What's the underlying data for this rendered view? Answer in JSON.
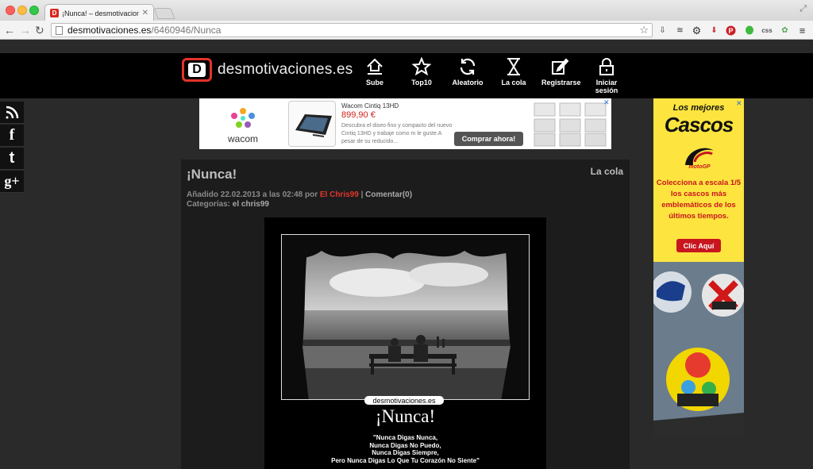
{
  "browser": {
    "tab_title": "¡Nunca! – desmotivaciones",
    "tab_close": "✕",
    "favicon_letter": "D",
    "url_domain": "desmotivaciones.es",
    "url_path": "/6460946/Nunca",
    "ext_css": "css"
  },
  "site": {
    "logo_letter": "D",
    "logo_text": "desmotivaciones.es",
    "nav": [
      {
        "label": "Sube"
      },
      {
        "label": "Top10"
      },
      {
        "label": "Aleatorio"
      },
      {
        "label": "La cola"
      },
      {
        "label": "Registrarse"
      },
      {
        "label": "Iniciar sesión"
      }
    ]
  },
  "social": [
    "rss",
    "f",
    "t",
    "g+"
  ],
  "top_ad": {
    "brand": "wacom",
    "title": "Wacom Cintiq 13HD",
    "price": "899,90 €",
    "description": "Descubra el diseo fino y compacto del nuevo Cintiq 13HD y trabaje como m le guste.A pesar de su reducido...",
    "button": "Comprar ahora!",
    "close": "✕"
  },
  "side_ad": {
    "line1": "Los mejores",
    "line2": "Cascos",
    "brand": "motoGP",
    "promo": "Colecciona a escala 1/5 los cascos más emblemáticos de los últimos tiempos.",
    "button": "Clic Aquí",
    "close": "✕"
  },
  "post": {
    "title": "¡Nunca!",
    "queue": "La cola",
    "meta_prefix": "Añadido 22.02.2013 a las 02:48 por ",
    "author": "El Chris99",
    "meta_sep": " | ",
    "comments": "Comentar(0)",
    "cats_label": "Categorías: ",
    "category": "el chris99"
  },
  "poster": {
    "watermark": "desmotivaciones.es",
    "title": "¡Nunca!",
    "lines": [
      "\"Nunca Digas Nunca,",
      "Nunca Digas No Puedo,",
      "Nunca Digas Siempre,",
      "Pero Nunca Digas Lo Que Tu Corazón No Siente\""
    ]
  },
  "colors": {
    "brand_red": "#e4322b",
    "header_bg": "#000000",
    "page_bg": "#2a2a2a",
    "post_bg": "#1c1c1c"
  }
}
